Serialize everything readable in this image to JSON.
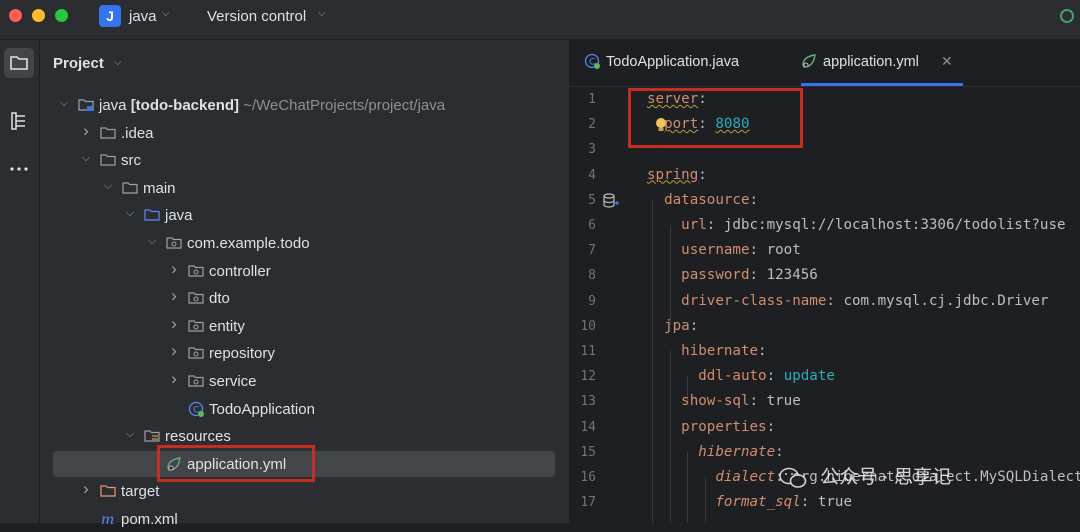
{
  "titlebar": {
    "project_badge": "J",
    "project_name": "java",
    "vcs_label": "Version control"
  },
  "project_panel": {
    "title": "Project",
    "tree": [
      {
        "depth": 0,
        "arrow": "down",
        "icon": "module-folder-icon",
        "label_bold": "java [todo-backend]",
        "suffix": "~/WeChatProjects/project/java"
      },
      {
        "depth": 1,
        "arrow": "right",
        "icon": "folder-icon",
        "label": ".idea"
      },
      {
        "depth": 1,
        "arrow": "down",
        "icon": "folder-icon",
        "label": "src"
      },
      {
        "depth": 2,
        "arrow": "down",
        "icon": "folder-icon",
        "label": "main"
      },
      {
        "depth": 3,
        "arrow": "down",
        "icon": "source-folder-icon",
        "label": "java"
      },
      {
        "depth": 4,
        "arrow": "down",
        "icon": "package-icon",
        "label": "com.example.todo"
      },
      {
        "depth": 5,
        "arrow": "right",
        "icon": "package-icon",
        "label": "controller"
      },
      {
        "depth": 5,
        "arrow": "right",
        "icon": "package-icon",
        "label": "dto"
      },
      {
        "depth": 5,
        "arrow": "right",
        "icon": "package-icon",
        "label": "entity"
      },
      {
        "depth": 5,
        "arrow": "right",
        "icon": "package-icon",
        "label": "repository"
      },
      {
        "depth": 5,
        "arrow": "right",
        "icon": "package-icon",
        "label": "service"
      },
      {
        "depth": 5,
        "arrow": "none",
        "icon": "spring-class-icon",
        "label": "TodoApplication"
      },
      {
        "depth": 3,
        "arrow": "down",
        "icon": "resources-folder-icon",
        "label": "resources"
      },
      {
        "depth": 4,
        "arrow": "none",
        "icon": "spring-config-icon",
        "label": "application.yml",
        "selected": true
      },
      {
        "depth": 1,
        "arrow": "right",
        "icon": "folder-excluded-icon",
        "label": "target"
      },
      {
        "depth": 1,
        "arrow": "none",
        "icon": "maven-icon",
        "label": "pom.xml"
      }
    ]
  },
  "editor": {
    "tabs": [
      {
        "label": "TodoApplication.java",
        "icon": "spring-class-icon",
        "active": false
      },
      {
        "label": "application.yml",
        "icon": "spring-config-icon",
        "active": true
      }
    ],
    "lines": [
      {
        "n": "1",
        "parts": [
          {
            "t": "server",
            "c": "k",
            "sq": true
          },
          {
            "t": ":",
            "c": "p"
          }
        ]
      },
      {
        "n": "2",
        "parts": [
          {
            "t": "  ",
            "c": "p"
          },
          {
            "t": "port",
            "c": "k",
            "sq": true
          },
          {
            "t": ": ",
            "c": "p"
          },
          {
            "t": "8080",
            "c": "n",
            "sq": true
          }
        ]
      },
      {
        "n": "3",
        "parts": []
      },
      {
        "n": "4",
        "parts": [
          {
            "t": "spring",
            "c": "k",
            "sq": true
          },
          {
            "t": ":",
            "c": "p"
          }
        ]
      },
      {
        "n": "5",
        "parts": [
          {
            "t": "  datasource",
            "c": "k"
          },
          {
            "t": ":",
            "c": "p"
          }
        ]
      },
      {
        "n": "6",
        "parts": [
          {
            "t": "    url",
            "c": "k"
          },
          {
            "t": ": jdbc:mysql://localhost:3306/todolist?use",
            "c": "s"
          }
        ]
      },
      {
        "n": "7",
        "parts": [
          {
            "t": "    username",
            "c": "k"
          },
          {
            "t": ": root",
            "c": "s"
          }
        ]
      },
      {
        "n": "8",
        "parts": [
          {
            "t": "    password",
            "c": "k"
          },
          {
            "t": ": 123456",
            "c": "s"
          }
        ]
      },
      {
        "n": "9",
        "parts": [
          {
            "t": "    driver-class-name",
            "c": "k"
          },
          {
            "t": ": com.mysql.cj.jdbc.Driver",
            "c": "s"
          }
        ]
      },
      {
        "n": "10",
        "parts": [
          {
            "t": "  jpa",
            "c": "k"
          },
          {
            "t": ":",
            "c": "p"
          }
        ]
      },
      {
        "n": "11",
        "parts": [
          {
            "t": "    hibernate",
            "c": "k"
          },
          {
            "t": ":",
            "c": "p"
          }
        ]
      },
      {
        "n": "12",
        "parts": [
          {
            "t": "      ddl-auto",
            "c": "k"
          },
          {
            "t": ": ",
            "c": "p"
          },
          {
            "t": "update",
            "c": "n"
          }
        ]
      },
      {
        "n": "13",
        "parts": [
          {
            "t": "    show-sql",
            "c": "k"
          },
          {
            "t": ": true",
            "c": "s"
          }
        ]
      },
      {
        "n": "14",
        "parts": [
          {
            "t": "    properties",
            "c": "k"
          },
          {
            "t": ":",
            "c": "p"
          }
        ]
      },
      {
        "n": "15",
        "parts": [
          {
            "t": "      hibernate",
            "c": "k it"
          },
          {
            "t": ":",
            "c": "p"
          }
        ]
      },
      {
        "n": "16",
        "parts": [
          {
            "t": "        dialect",
            "c": "k it"
          },
          {
            "t": ": org.hibernate.dialect.MySQLDialect",
            "c": "s"
          }
        ]
      },
      {
        "n": "17",
        "parts": [
          {
            "t": "        format_sql",
            "c": "k it"
          },
          {
            "t": ": true",
            "c": "s"
          }
        ]
      }
    ]
  },
  "watermark": {
    "text": "公众号 · 思享记"
  },
  "colors": {
    "accent": "#3574f0",
    "highlight_box": "#c62d22"
  }
}
